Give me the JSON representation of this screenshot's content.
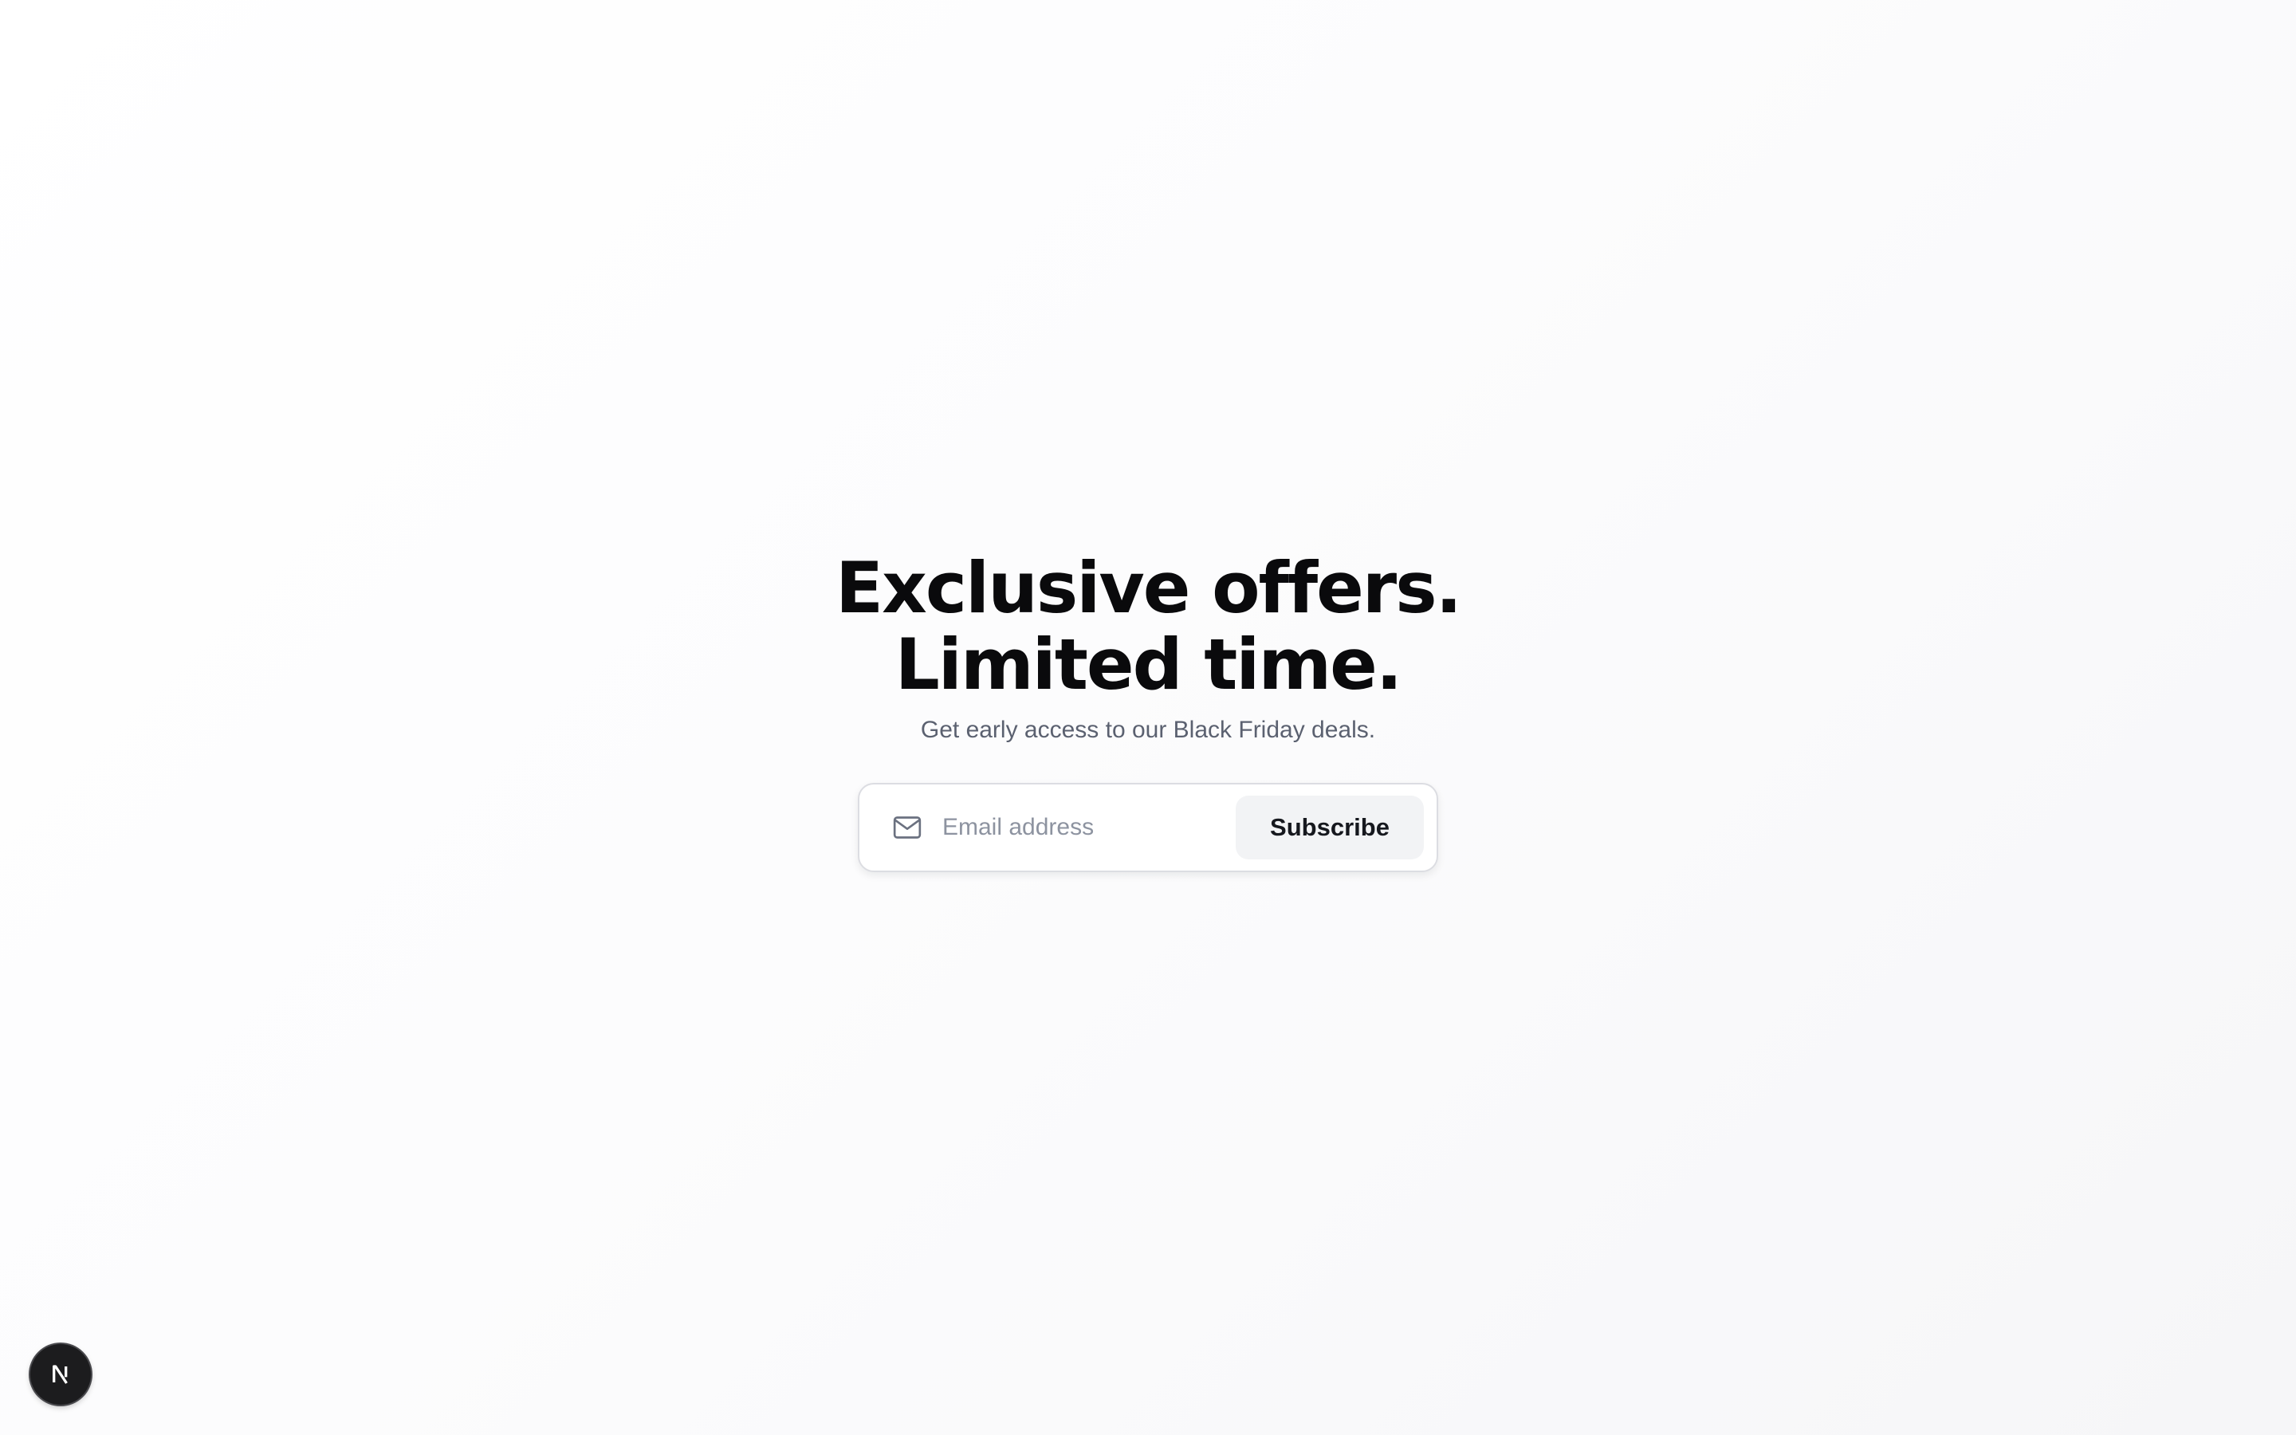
{
  "hero": {
    "headline_line1": "Exclusive offers.",
    "headline_line2": "Limited time.",
    "subtitle": "Get early access to our Black Friday deals."
  },
  "subscribe_form": {
    "icon": "mail-icon",
    "email_placeholder": "Email address",
    "email_value": "",
    "button_label": "Subscribe"
  },
  "dev_badge": {
    "icon": "nextjs-logo-icon",
    "letter": "N"
  },
  "colors": {
    "headline": "#0a0a0c",
    "subtitle": "#5b6170",
    "placeholder": "#8d93a0",
    "button_bg": "#f2f3f5",
    "badge_bg": "#1c1c1e"
  }
}
